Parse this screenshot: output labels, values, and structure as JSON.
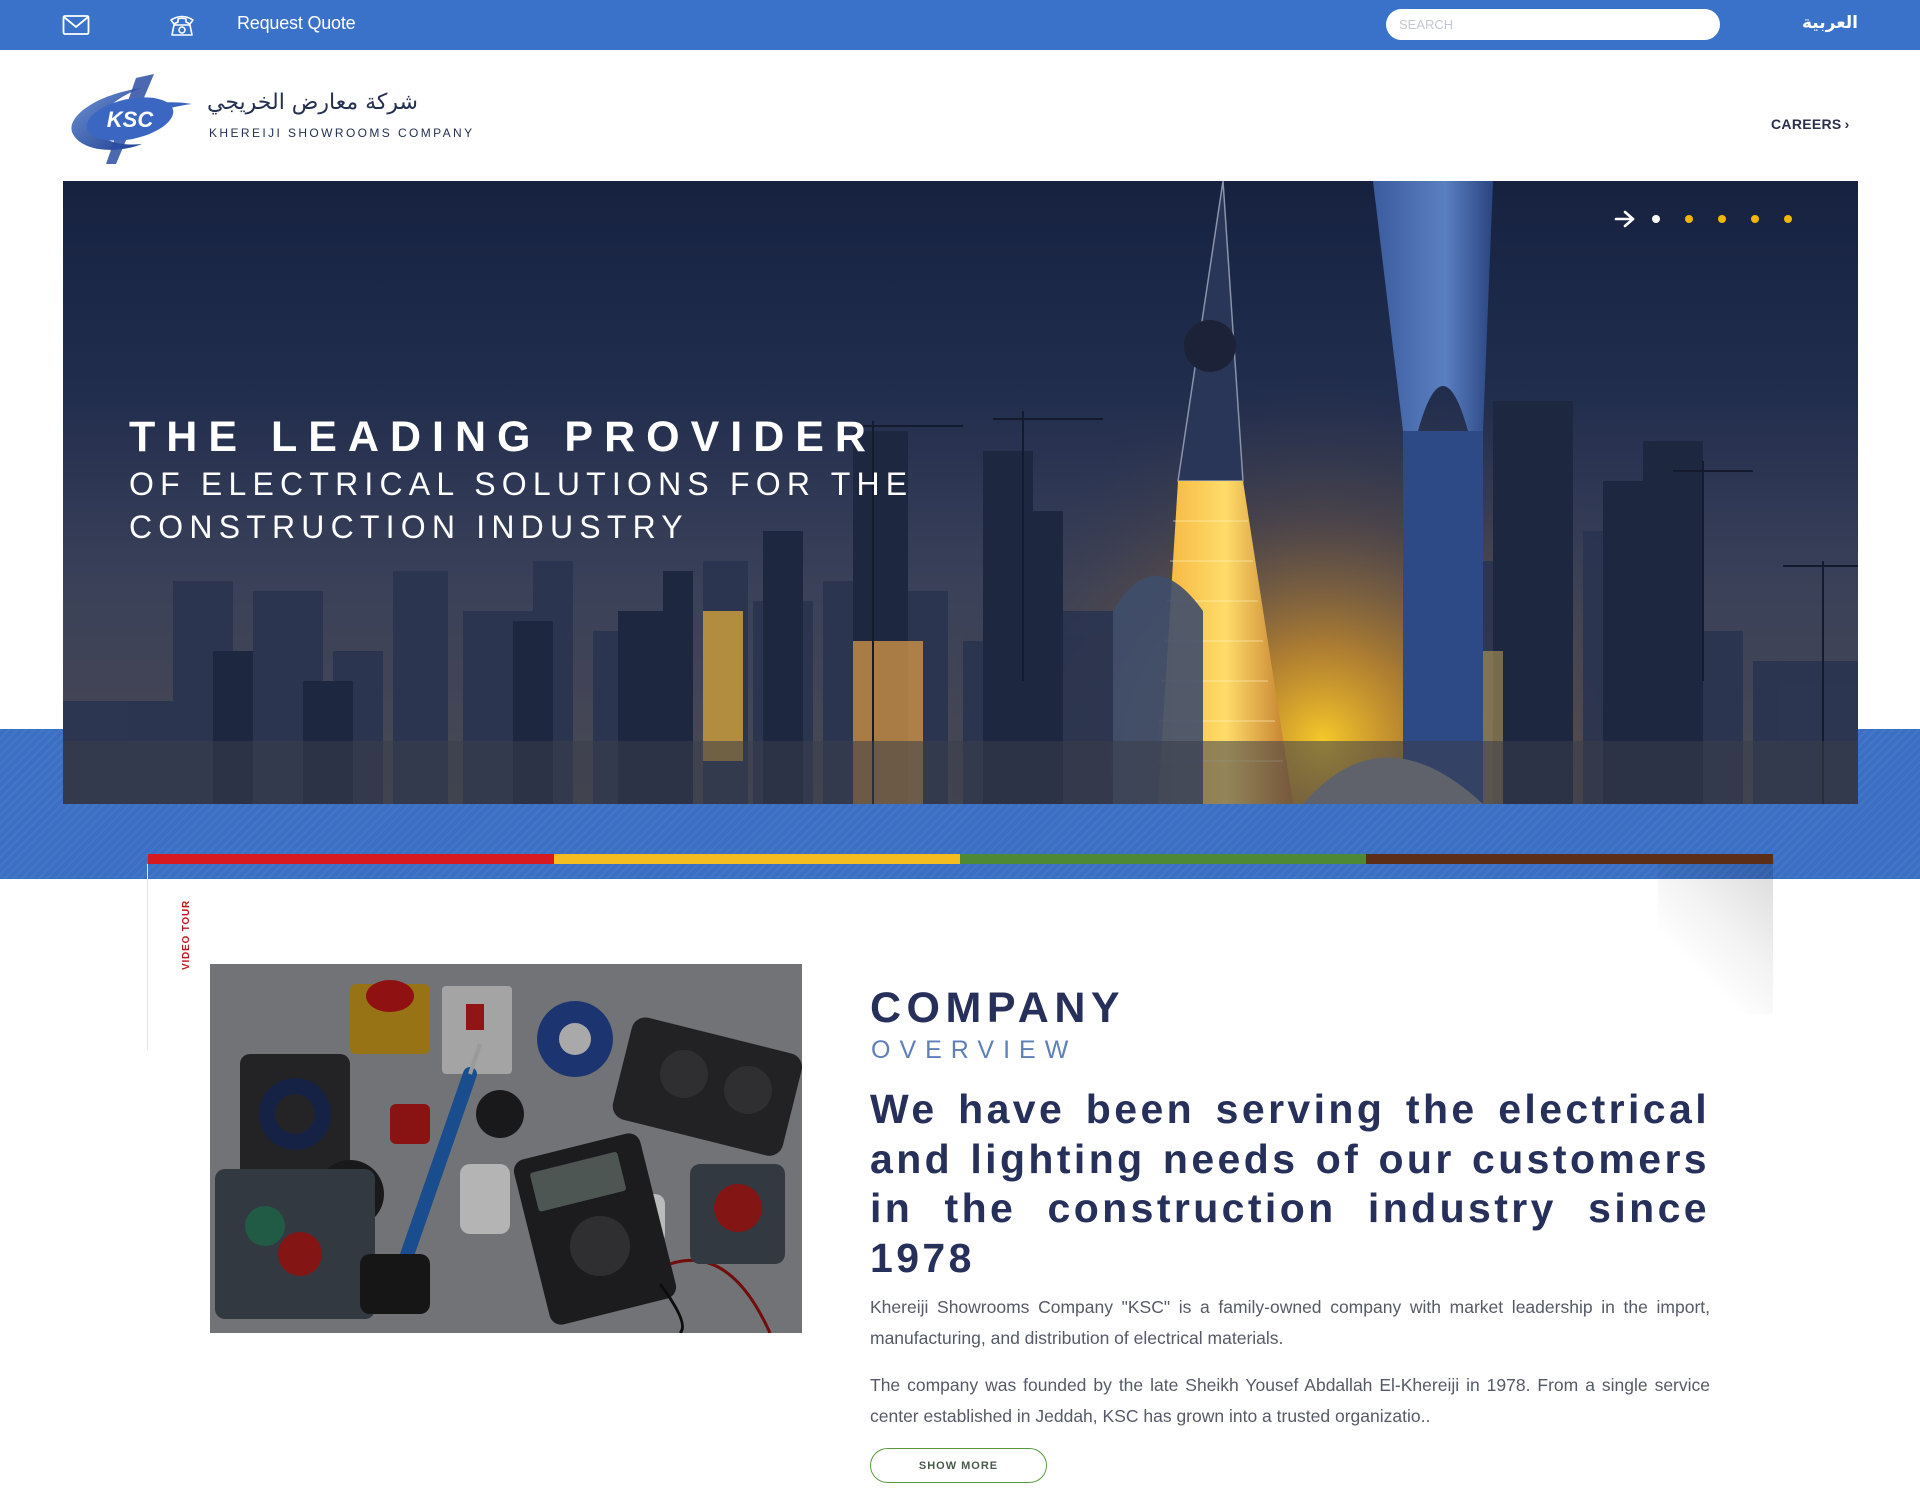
{
  "topbar": {
    "quote_label": "Request Quote",
    "search_placeholder": "SEARCH",
    "language_label": "العربية",
    "icons": [
      "mail-icon",
      "phone-icon"
    ],
    "background": "#3a72c9"
  },
  "header": {
    "logo_abbrev": "KSC",
    "logo_arabic": "شركة معارض الخريجي",
    "logo_english": "KHEREIJI SHOWROOMS COMPANY",
    "careers_label": "CAREERS",
    "careers_icon": "chevron-right-icon"
  },
  "hero": {
    "headline_line1": "THE LEADING PROVIDER",
    "headline_line2": "OF ELECTRICAL SOLUTIONS FOR THE",
    "headline_line3": "CONSTRUCTION INDUSTRY",
    "slide_count": 5,
    "active_slide": 1,
    "next_icon": "arrow-right-icon",
    "dot_color": "#f2b705"
  },
  "stripes": [
    "#d71920",
    "#f5bd1f",
    "#4e8a35",
    "#5c2e17"
  ],
  "overview": {
    "video_label": "VIDEO TOUR",
    "title": "COMPANY",
    "subtitle": "OVERVIEW",
    "lead": "We have been serving the electrical and lighting needs of our customers in the construction industry since 1978",
    "paragraph1": "Khereiji Showrooms Company \"KSC\" is a family-owned company with market leadership in the import, manufacturing, and distribution of electrical materials.",
    "paragraph2": "The company was founded by the late Sheikh Yousef Abdallah El-Khereiji in 1978. From a single service center established in Jeddah, KSC has grown into a trusted organizatio..",
    "show_more_label": "SHOW MORE"
  }
}
